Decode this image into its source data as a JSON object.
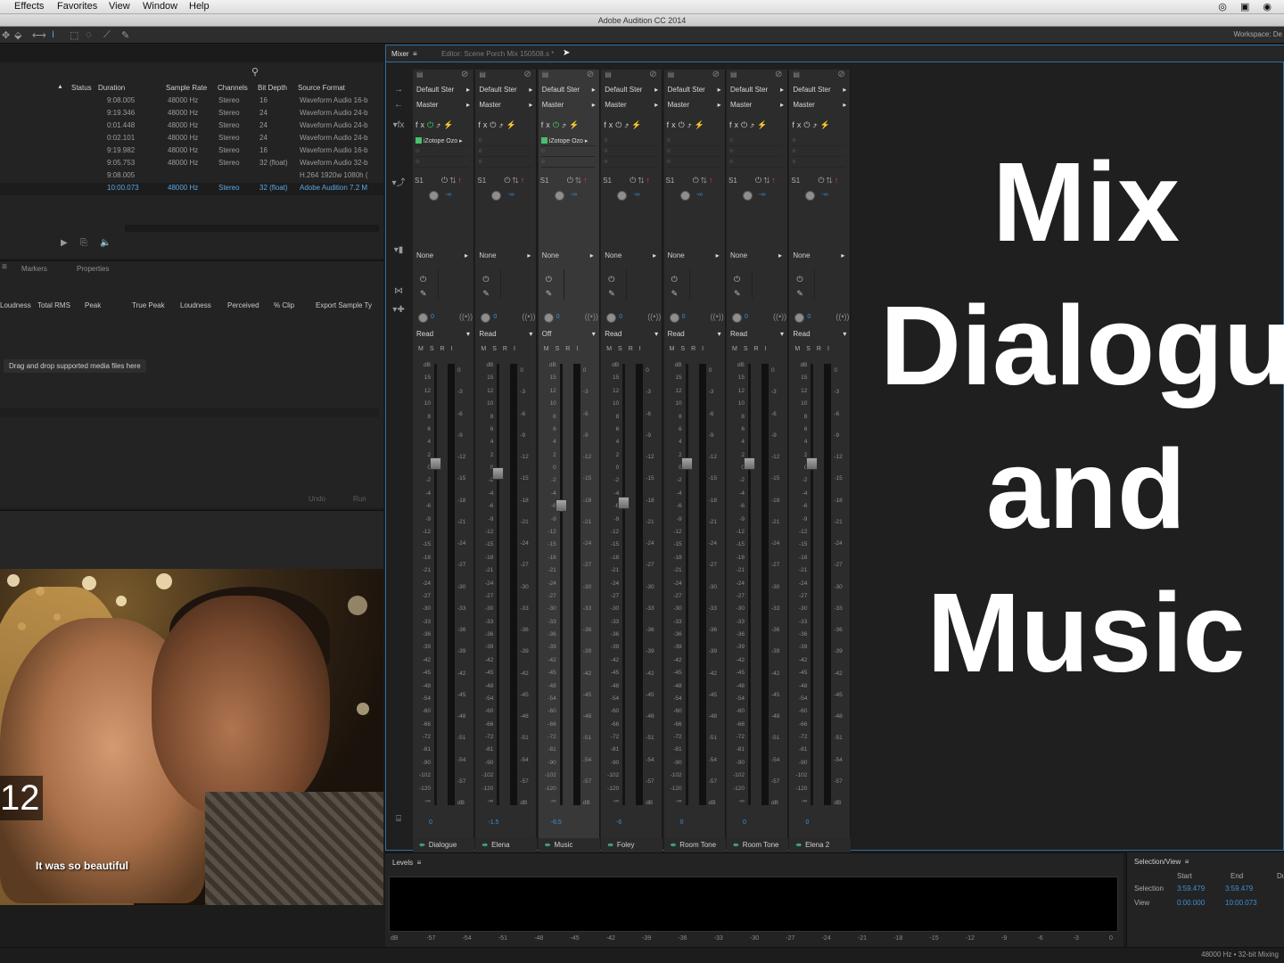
{
  "menu": [
    "Effects",
    "Favorites",
    "View",
    "Window",
    "Help"
  ],
  "window_title": "Adobe Audition CC 2014",
  "workspace_label": "Workspace:",
  "workspace_value": "De",
  "files_panel": {
    "columns": [
      "Status",
      "Duration",
      "Sample Rate",
      "Channels",
      "Bit Depth",
      "Source Format"
    ],
    "rows": [
      [
        "9:08.005",
        "48000 Hz",
        "Stereo",
        "16",
        "Waveform Audio 16-b"
      ],
      [
        "9:19.346",
        "48000 Hz",
        "Stereo",
        "24",
        "Waveform Audio 24-b"
      ],
      [
        "0:01.448",
        "48000 Hz",
        "Stereo",
        "24",
        "Waveform Audio 24-b"
      ],
      [
        "0:02.101",
        "48000 Hz",
        "Stereo",
        "24",
        "Waveform Audio 24-b"
      ],
      [
        "9:19.982",
        "48000 Hz",
        "Stereo",
        "16",
        "Waveform Audio 16-b"
      ],
      [
        "9:05.753",
        "48000 Hz",
        "Stereo",
        "32 (float)",
        "Waveform Audio 32-b"
      ],
      [
        "9:08.005",
        "",
        "",
        "",
        "H.264 1920w 1080h ("
      ],
      [
        "10:00.073",
        "48000 Hz",
        "Stereo",
        "32 (float)",
        "Adobe Audition 7.2 M"
      ]
    ]
  },
  "match_panel": {
    "tabs": [
      "Markers",
      "Properties"
    ],
    "columns": [
      "Loudness",
      "Total RMS",
      "Peak",
      "True Peak",
      "Loudness",
      "Perceived",
      "% Clip",
      "Export Sample Ty"
    ],
    "drop_hint": "Drag and drop supported media files here",
    "undo_label": "Undo",
    "run_label": "Run"
  },
  "video": {
    "timecode": "12",
    "subtitle": "It was so beautiful"
  },
  "mixer": {
    "tab_mixer": "Mixer",
    "tab_editor": "Editor: Scene Porch Mix 150508.s",
    "tab_editor_suffix": "*",
    "input_label": "Default Ster",
    "output_label": "Master",
    "send_label": "S1",
    "none_label": "None",
    "db_label": "dB",
    "tracks": [
      {
        "name": "Dialogue",
        "automation": "Read",
        "fader": "0",
        "color": "#49b867",
        "effect": "iZotope Ozo",
        "fader_db": 0
      },
      {
        "name": "Elena",
        "automation": "Read",
        "fader": "-1.5",
        "color": "#b4b43c",
        "effect": "",
        "fader_db": -1.5
      },
      {
        "name": "Music",
        "automation": "Off",
        "fader": "-6.5",
        "color": "#d94040",
        "effect": "iZotope Ozo",
        "fader_db": -6.5
      },
      {
        "name": "Foley",
        "automation": "Read",
        "fader": "-6",
        "color": "#d05a5a",
        "effect": "",
        "fader_db": -6
      },
      {
        "name": "Room Tone",
        "automation": "Read",
        "fader": "0",
        "color": "#3cb8c8",
        "effect": "",
        "fader_db": 0
      },
      {
        "name": "Room Tone",
        "automation": "Read",
        "fader": "0",
        "color": "#b048a8",
        "effect": "",
        "fader_db": 0
      },
      {
        "name": "Elena 2",
        "automation": "Read",
        "fader": "0",
        "color": "#8a44c8",
        "effect": "",
        "fader_db": 0
      }
    ],
    "scale_left": [
      "dB",
      "15",
      "12",
      "10",
      "8",
      "6",
      "4",
      "2",
      "0",
      "-2",
      "-4",
      "-6",
      "-9",
      "-12",
      "-15",
      "-18",
      "-21",
      "-24",
      "-27",
      "-30",
      "-33",
      "-36",
      "-39",
      "-42",
      "-45",
      "-48",
      "-54",
      "-60",
      "-66",
      "-72",
      "-81",
      "-90",
      "-102",
      "-120",
      "-∞"
    ],
    "scale_right": [
      "0",
      "-3",
      "-6",
      "-9",
      "-12",
      "-15",
      "-18",
      "-21",
      "-24",
      "-27",
      "-30",
      "-33",
      "-36",
      "-39",
      "-42",
      "-45",
      "-48",
      "-51",
      "-54",
      "-57",
      "dB"
    ]
  },
  "overlay_text": [
    "Mix",
    "Dialogu",
    "and",
    "Music"
  ],
  "levels": {
    "label": "Levels",
    "ticks": [
      "dB",
      "-57",
      "-54",
      "-51",
      "-48",
      "-45",
      "-42",
      "-39",
      "-36",
      "-33",
      "-30",
      "-27",
      "-24",
      "-21",
      "-18",
      "-15",
      "-12",
      "-9",
      "-6",
      "-3",
      "0"
    ]
  },
  "selection_view": {
    "label": "Selection/View",
    "start": "Start",
    "end": "End",
    "dur": "Du",
    "selection_label": "Selection",
    "selection_start": "3:59.479",
    "selection_end": "3:59.479",
    "view_label": "View",
    "view_start": "0:00.000",
    "view_end": "10:00.073"
  },
  "status": "48000 Hz • 32-bit Mixing"
}
